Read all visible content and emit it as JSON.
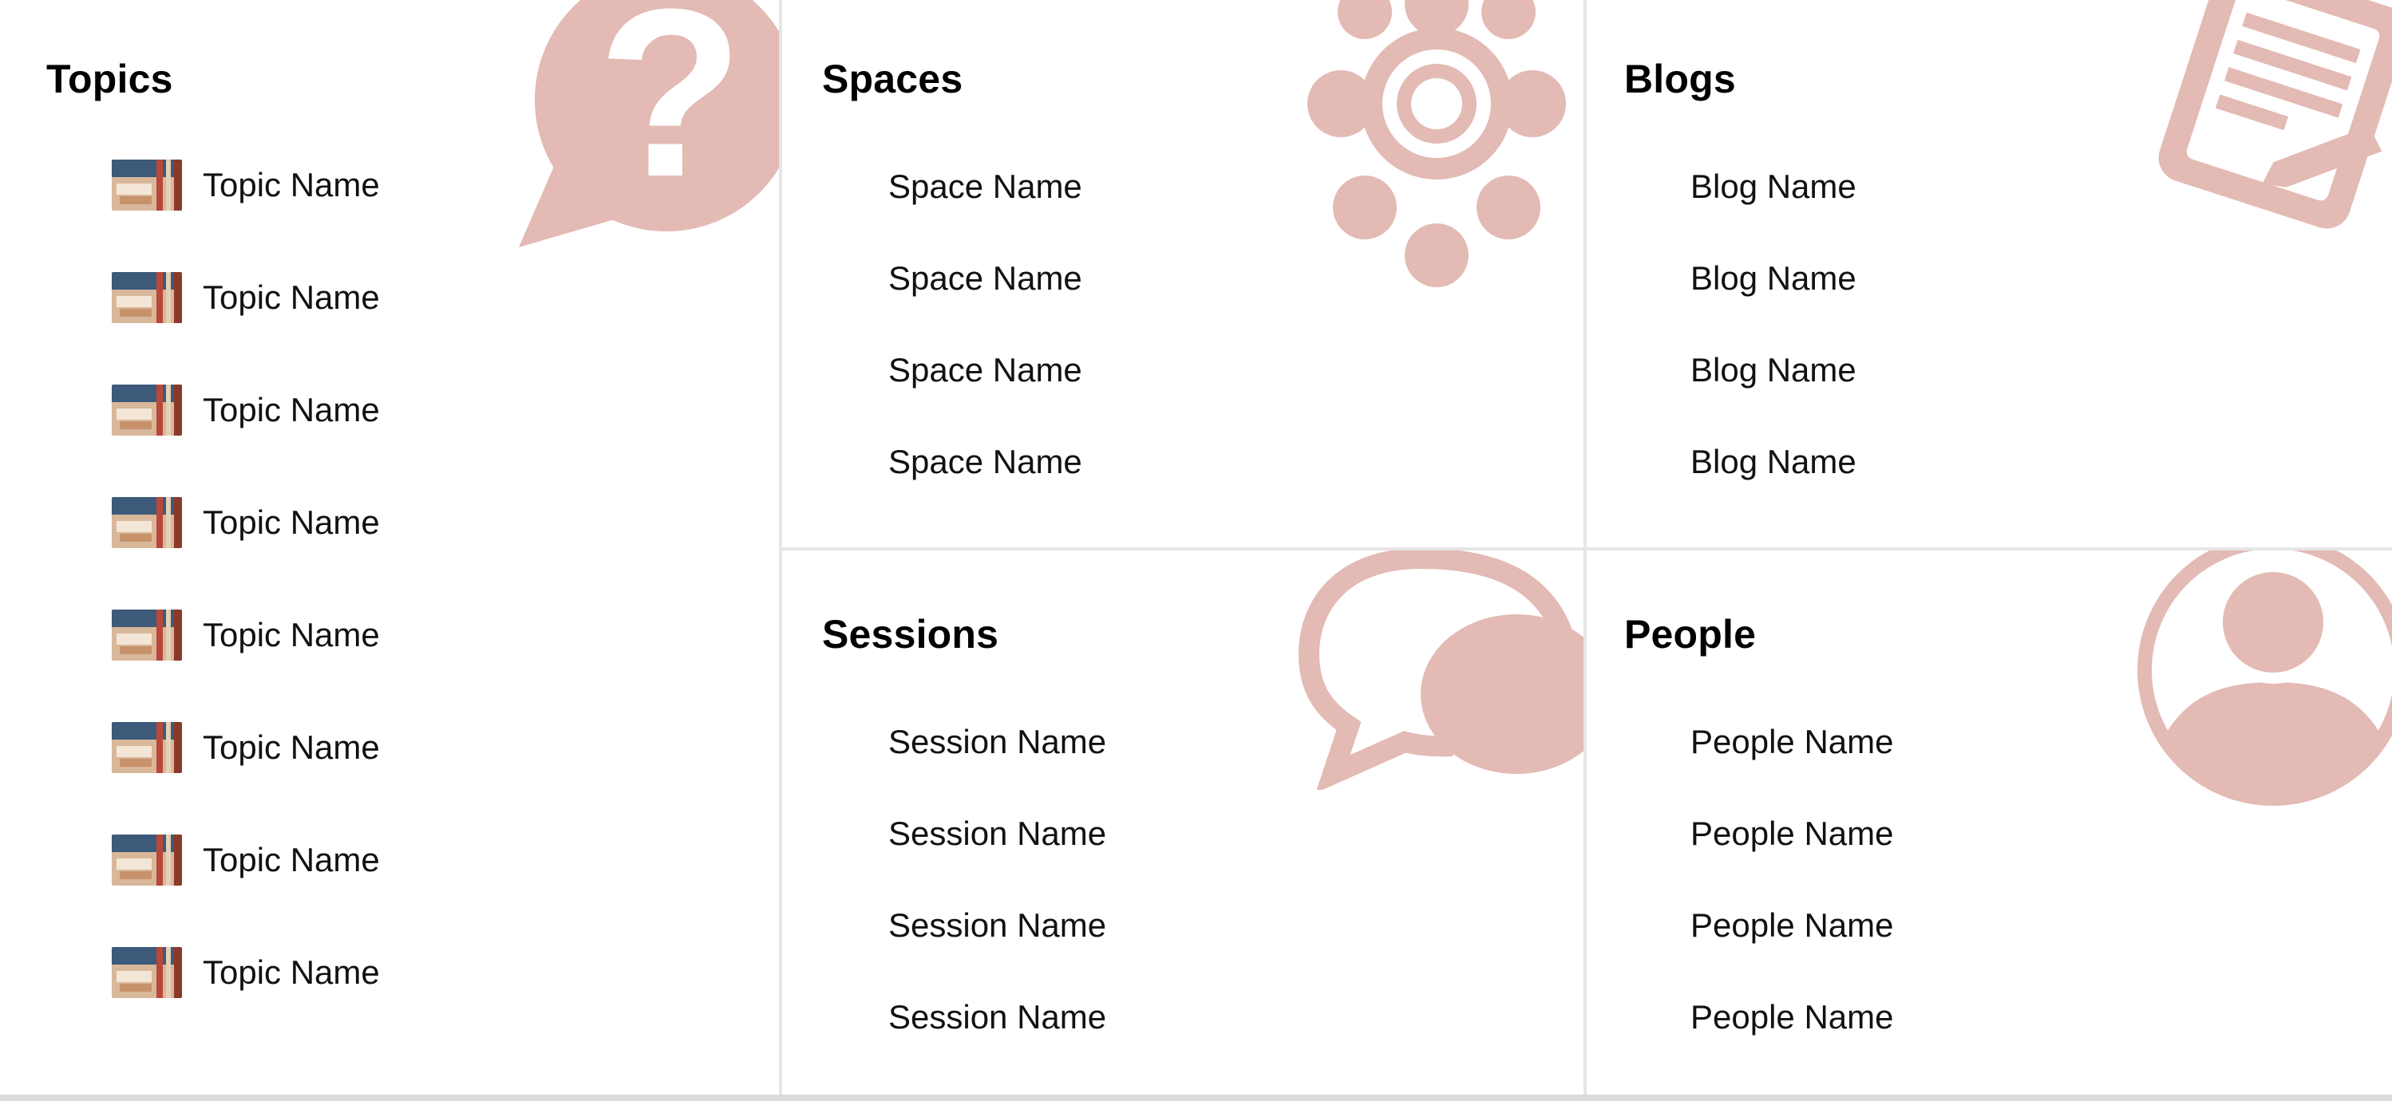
{
  "colors": {
    "accent": "#e3bab4",
    "divider": "#e6e6e6",
    "text": "#111111"
  },
  "topics": {
    "title": "Topics",
    "icon": "question-bubble-icon",
    "items": [
      {
        "label": "Topic Name"
      },
      {
        "label": "Topic Name"
      },
      {
        "label": "Topic Name"
      },
      {
        "label": "Topic Name"
      },
      {
        "label": "Topic Name"
      },
      {
        "label": "Topic Name"
      },
      {
        "label": "Topic Name"
      },
      {
        "label": "Topic Name"
      }
    ]
  },
  "spaces": {
    "title": "Spaces",
    "icon": "network-gear-icon",
    "items": [
      {
        "label": "Space Name"
      },
      {
        "label": "Space Name"
      },
      {
        "label": "Space Name"
      },
      {
        "label": "Space Name"
      }
    ]
  },
  "blogs": {
    "title": "Blogs",
    "icon": "document-edit-icon",
    "items": [
      {
        "label": "Blog Name"
      },
      {
        "label": "Blog Name"
      },
      {
        "label": "Blog Name"
      },
      {
        "label": "Blog Name"
      }
    ]
  },
  "sessions": {
    "title": "Sessions",
    "icon": "chat-bubbles-icon",
    "items": [
      {
        "label": "Session Name"
      },
      {
        "label": "Session Name"
      },
      {
        "label": "Session Name"
      },
      {
        "label": "Session Name"
      }
    ]
  },
  "people": {
    "title": "People",
    "icon": "person-avatar-icon",
    "items": [
      {
        "label": "People Name"
      },
      {
        "label": "People Name"
      },
      {
        "label": "People Name"
      },
      {
        "label": "People Name"
      }
    ]
  }
}
